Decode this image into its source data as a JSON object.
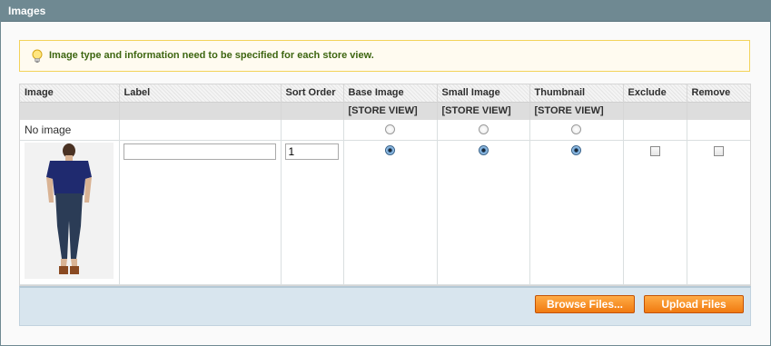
{
  "panel": {
    "title": "Images"
  },
  "notice": {
    "icon": "lightbulb-icon",
    "text": "Image type and information need to be specified for each store view."
  },
  "table": {
    "headers": {
      "image": "Image",
      "label": "Label",
      "sort_order": "Sort Order",
      "base_image": "Base Image",
      "small_image": "Small Image",
      "thumbnail": "Thumbnail",
      "exclude": "Exclude",
      "remove": "Remove",
      "scope": "[STORE VIEW]"
    },
    "no_image_row": {
      "label": "No image"
    },
    "image_row": {
      "label_value": "",
      "sort_order_value": "1",
      "base_image_selected": true,
      "small_image_selected": true,
      "thumbnail_selected": true,
      "exclude_checked": false,
      "remove_checked": false
    }
  },
  "footer": {
    "browse_label": "Browse Files...",
    "upload_label": "Upload Files"
  },
  "colors": {
    "header_bar": "#6f8992",
    "button_orange": "#f07a10",
    "notice_text": "#3d6611",
    "footer_bg": "#d8e5ee"
  }
}
